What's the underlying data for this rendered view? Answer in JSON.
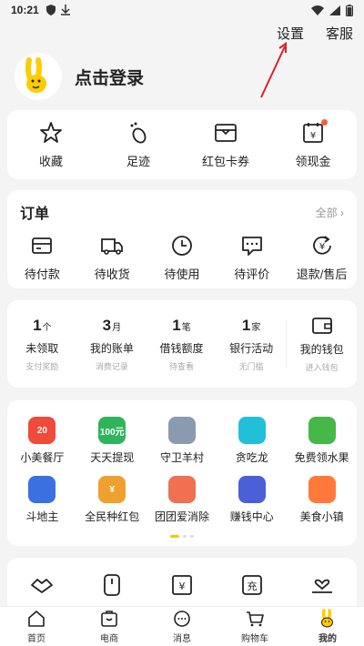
{
  "status": {
    "time": "10:21"
  },
  "topbar": {
    "settings": "设置",
    "service": "客服"
  },
  "profile": {
    "login": "点击登录"
  },
  "quick": [
    {
      "label": "收藏",
      "icon": "star-icon"
    },
    {
      "label": "足迹",
      "icon": "footprint-icon"
    },
    {
      "label": "红包卡券",
      "icon": "coupon-icon"
    },
    {
      "label": "领现金",
      "icon": "cash-icon"
    }
  ],
  "orders": {
    "title": "订单",
    "all": "全部 ›",
    "items": [
      {
        "label": "待付款",
        "icon": "card-icon"
      },
      {
        "label": "待收货",
        "icon": "truck-icon"
      },
      {
        "label": "待使用",
        "icon": "clock-icon"
      },
      {
        "label": "待评价",
        "icon": "comment-icon"
      },
      {
        "label": "退款/售后",
        "icon": "refund-icon"
      }
    ]
  },
  "wallet": {
    "items": [
      {
        "num": "1",
        "unit": "个",
        "label": "未领取",
        "sub": "支付奖励"
      },
      {
        "num": "3",
        "unit": "月",
        "label": "我的账单",
        "sub": "消费记录"
      },
      {
        "num": "1",
        "unit": "笔",
        "label": "借钱额度",
        "sub": "待查看"
      },
      {
        "num": "1",
        "unit": "家",
        "label": "银行活动",
        "sub": "无门槛"
      }
    ],
    "mine": {
      "label": "我的钱包",
      "sub": "进入钱包"
    }
  },
  "services": [
    {
      "label": "小美餐厅",
      "badge": "20",
      "color": "#f04a3a"
    },
    {
      "label": "天天提现",
      "badge": "100元",
      "color": "#2fb45a"
    },
    {
      "label": "守卫羊村",
      "badge": "",
      "color": "#8a9bb0"
    },
    {
      "label": "贪吃龙",
      "badge": "",
      "color": "#22c0d8"
    },
    {
      "label": "免费领水果",
      "badge": "",
      "color": "#45b848"
    },
    {
      "label": "斗地主",
      "badge": "",
      "color": "#3a70e0"
    },
    {
      "label": "全民种红包",
      "badge": "¥",
      "color": "#f0a030"
    },
    {
      "label": "团团爱消除",
      "badge": "",
      "color": "#f07050"
    },
    {
      "label": "赚钱中心",
      "badge": "",
      "color": "#4a5fd8"
    },
    {
      "label": "美食小镇",
      "badge": "",
      "color": "#ff7a3a"
    }
  ],
  "tabs": [
    {
      "label": "首页",
      "icon": "home-icon"
    },
    {
      "label": "电商",
      "icon": "shop-icon"
    },
    {
      "label": "消息",
      "icon": "message-icon"
    },
    {
      "label": "购物车",
      "icon": "cart-icon"
    },
    {
      "label": "我的",
      "icon": "mine-icon"
    }
  ]
}
